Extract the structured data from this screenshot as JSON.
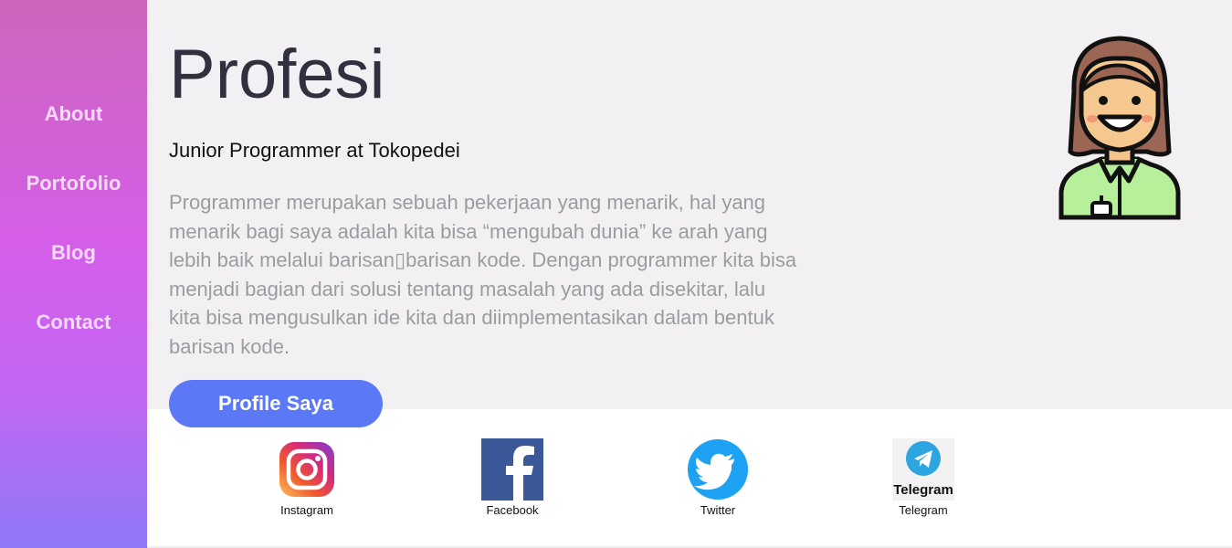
{
  "nav": {
    "items": [
      {
        "label": "About"
      },
      {
        "label": "Portofolio"
      },
      {
        "label": "Blog"
      },
      {
        "label": "Contact"
      }
    ]
  },
  "hero": {
    "title": "Profesi",
    "subtitle": "Junior Programmer at Tokopedei",
    "description": "Programmer merupakan sebuah pekerjaan yang menarik, hal yang menarik bagi saya adalah kita bisa “mengubah dunia” ke arah yang lebih baik melalui barisan▯barisan kode. Dengan programmer kita bisa menjadi bagian dari solusi tentang masalah yang ada disekitar, lalu kita bisa mengusulkan ide kita dan diimplementasikan dalam bentuk barisan kode.",
    "button_label": "Profile Saya"
  },
  "social": [
    {
      "label": "Instagram",
      "icon": "instagram-icon"
    },
    {
      "label": "Facebook",
      "icon": "facebook-icon"
    },
    {
      "label": "Twitter",
      "icon": "twitter-icon"
    },
    {
      "label": "Telegram",
      "icon": "telegram-icon",
      "logo_text": "Telegram"
    }
  ],
  "colors": {
    "sidebar_gradient": [
      "#cc66bb",
      "#d45ee8",
      "#8f78f6"
    ],
    "button": "#5b79f6",
    "hero_bg": "#f2f0f2",
    "title": "#32303f",
    "description": "#9a9ca0"
  }
}
